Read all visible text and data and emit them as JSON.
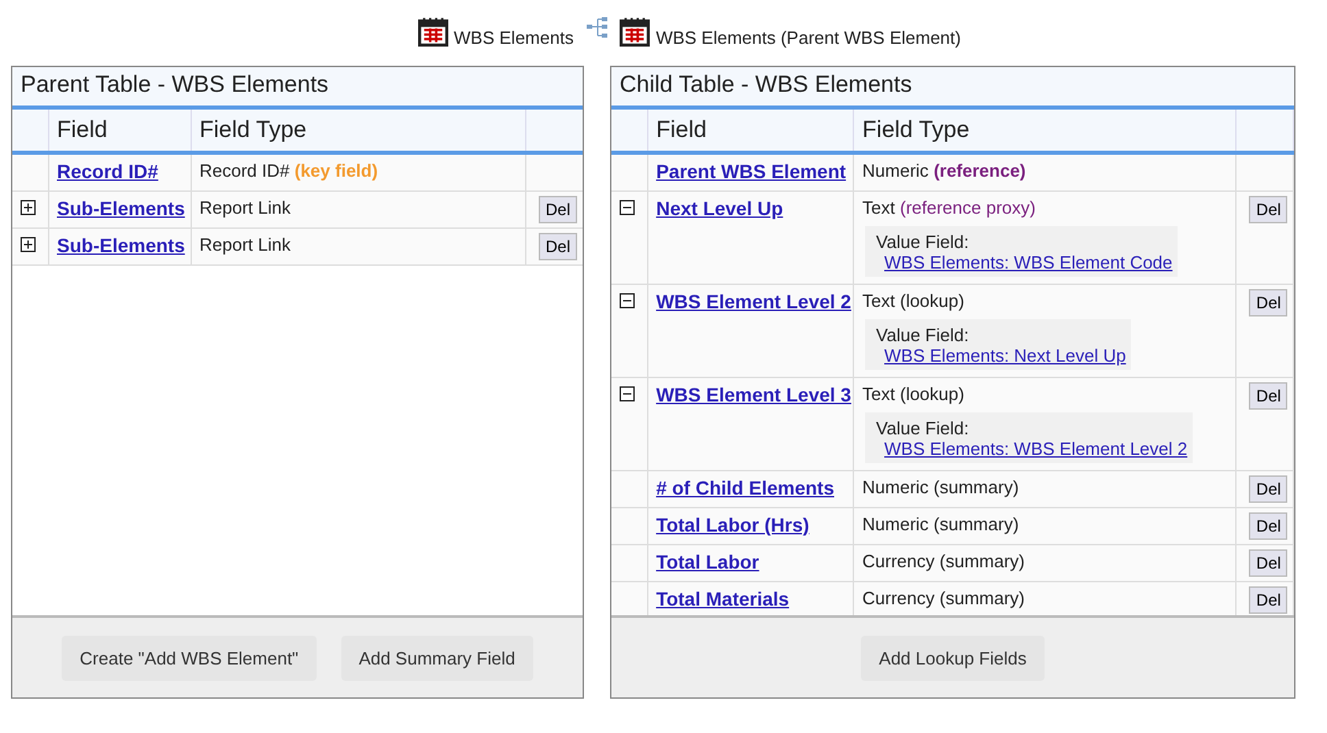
{
  "header": {
    "source_table": "WBS Elements",
    "target_table": "WBS Elements (Parent WBS Element)"
  },
  "panels": [
    {
      "title": "Parent Table - WBS Elements",
      "columns": [
        "Field",
        "Field Type"
      ],
      "rows": [
        {
          "field": "Record ID#",
          "type": "Record ID#",
          "qualifier": "(key field)",
          "color": "#f39a2e",
          "qualifier_bold": true,
          "deletable": false
        },
        {
          "expanded": false,
          "field": "Sub-Elements",
          "type": "Report Link",
          "deletable": true,
          "delete_label": "Del"
        },
        {
          "expanded": false,
          "field": "Sub-Elements",
          "type": "Report Link",
          "deletable": true,
          "delete_label": "Del"
        }
      ],
      "buttons": [
        "Create \"Add WBS Element\"",
        "Add Summary Field"
      ]
    },
    {
      "title": "Child Table - WBS Elements",
      "columns": [
        "Field",
        "Field Type"
      ],
      "rows": [
        {
          "field": "Parent WBS Element",
          "type": "Numeric",
          "qualifier": "(reference)",
          "color": "#7a1f7e",
          "qualifier_bold": true,
          "deletable": false
        },
        {
          "expanded": true,
          "field": "Next Level Up",
          "type": "Text",
          "qualifier": "(reference proxy)",
          "color": "#7a1f7e",
          "qualifier_bold": false,
          "value_field": {
            "label": "Value Field:",
            "link": "WBS Elements: WBS Element Code"
          },
          "deletable": true,
          "delete_label": "Del"
        },
        {
          "expanded": true,
          "field": "WBS Element Level 2",
          "type": "Text (lookup)",
          "value_field": {
            "label": "Value Field:",
            "link": "WBS Elements: Next Level Up"
          },
          "deletable": true,
          "delete_label": "Del"
        },
        {
          "expanded": true,
          "field": "WBS Element Level 3",
          "type": "Text (lookup)",
          "value_field": {
            "label": "Value Field:",
            "link": "WBS Elements: WBS Element Level 2"
          },
          "deletable": true,
          "delete_label": "Del"
        },
        {
          "field": "# of Child Elements",
          "type": "Numeric (summary)",
          "deletable": true,
          "delete_label": "Del"
        },
        {
          "field": "Total Labor (Hrs)",
          "type": "Numeric (summary)",
          "deletable": true,
          "delete_label": "Del"
        },
        {
          "field": "Total Labor",
          "type": "Currency (summary)",
          "deletable": true,
          "delete_label": "Del"
        },
        {
          "field": "Total Materials",
          "type": "Currency (summary)",
          "deletable": true,
          "delete_label": "Del"
        }
      ],
      "buttons": [
        "Add Lookup Fields"
      ]
    }
  ]
}
